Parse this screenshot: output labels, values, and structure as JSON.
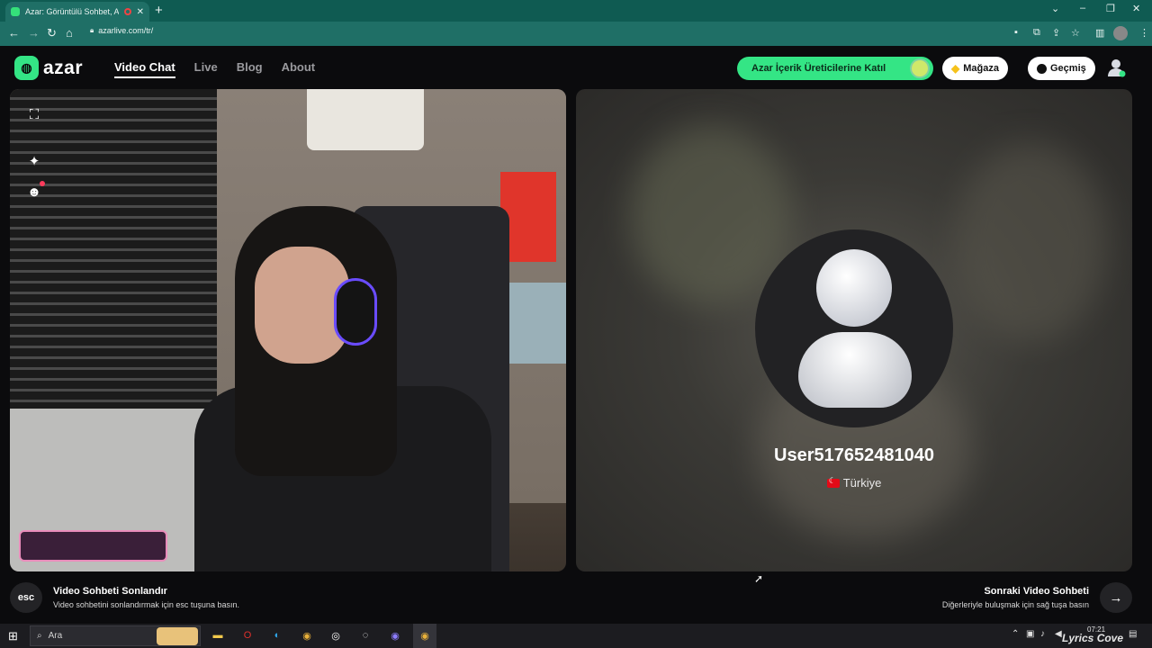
{
  "browser": {
    "tab_title": "Azar: Görüntülü Sohbet, Arkad...",
    "tab_close": "✕",
    "new_tab": "+",
    "url": "azarlive.com/tr/",
    "win_min": "–",
    "win_max": "❐",
    "win_close": "✕",
    "win_dropdown": "⌄"
  },
  "header": {
    "logo_text": "azar",
    "nav": [
      {
        "label": "Video Chat",
        "active": true
      },
      {
        "label": "Live",
        "active": false
      },
      {
        "label": "Blog",
        "active": false
      },
      {
        "label": "About",
        "active": false
      }
    ],
    "creator_label": "Azar İçerik Üreticilerine Katıl",
    "store_label": "Mağaza",
    "history_label": "Geçmiş"
  },
  "side_icons": [
    "expand-icon",
    "sparkle-icon",
    "emoji-icon"
  ],
  "peer": {
    "username": "User517652481040",
    "country": "Türkiye"
  },
  "bottom": {
    "esc_key": "esc",
    "end_title": "Video Sohbeti Sonlandır",
    "end_sub": "Video sohbetini sonlandırmak için esc tuşuna basın.",
    "next_title": "Sonraki Video Sohbeti",
    "next_sub": "Diğerleriyle buluşmak için sağ tuşa basın",
    "next_arrow": "→"
  },
  "taskbar": {
    "search_placeholder": "Ara",
    "time": "07:21"
  },
  "watermark": "Lyrics Cove",
  "colors": {
    "accent_green": "#34e585",
    "browser_teal": "#1f6f66",
    "background": "#0b0b0d"
  }
}
